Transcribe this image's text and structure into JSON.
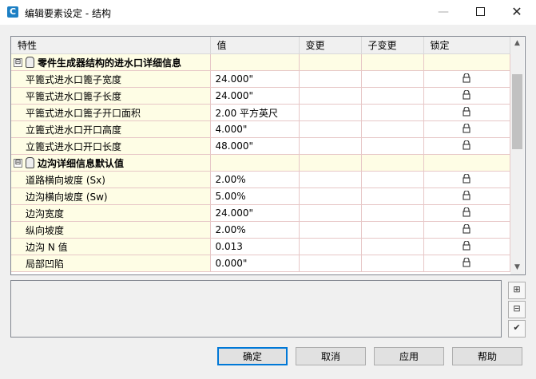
{
  "window": {
    "app_icon_letter": "C",
    "title": "编辑要素设定 - 结构",
    "min_label": "—",
    "close_label": "✕"
  },
  "grid": {
    "columns": [
      "特性",
      "值",
      "变更",
      "子变更",
      "锁定"
    ],
    "expander_symbol": "⊟",
    "lock_icon": "lock-icon",
    "categories": [
      {
        "label": "零件生成器结构的进水口详细信息",
        "rows": [
          {
            "name": "平篦式进水口篦子宽度",
            "value": "24.000\""
          },
          {
            "name": "平篦式进水口篦子长度",
            "value": "24.000\""
          },
          {
            "name": "平篦式进水口篦子开口面积",
            "value": "2.00 平方英尺"
          },
          {
            "name": "立篦式进水口开口高度",
            "value": "4.000\""
          },
          {
            "name": "立篦式进水口开口长度",
            "value": "48.000\""
          }
        ]
      },
      {
        "label": "边沟详细信息默认值",
        "rows": [
          {
            "name": "道路横向坡度 (Sx)",
            "value": "2.00%"
          },
          {
            "name": "边沟横向坡度 (Sw)",
            "value": "5.00%"
          },
          {
            "name": "边沟宽度",
            "value": "24.000\""
          },
          {
            "name": "纵向坡度",
            "value": "2.00%"
          },
          {
            "name": "边沟 N 值",
            "value": "0.013"
          },
          {
            "name": "局部凹陷",
            "value": "0.000\""
          }
        ]
      }
    ]
  },
  "buttons": {
    "ok": "确定",
    "cancel": "取消",
    "apply": "应用",
    "help": "帮助"
  }
}
